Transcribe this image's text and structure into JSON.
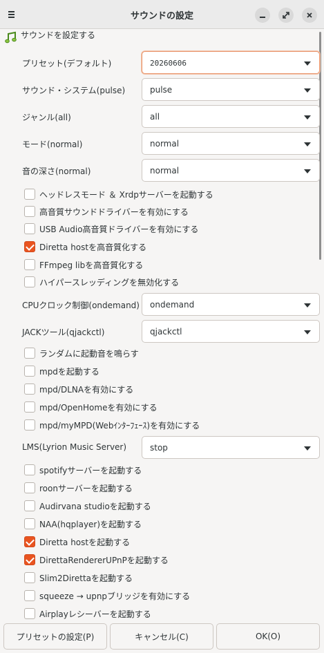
{
  "window": {
    "title": "サウンドの設定"
  },
  "header": {
    "label": "サウンドを設定する",
    "icon": "music-note-icon"
  },
  "preset": {
    "label": "プリセット(デフォルト)",
    "value": "20260606"
  },
  "sound_system": {
    "label": "サウンド・システム(pulse)",
    "value": "pulse"
  },
  "genre": {
    "label": "ジャンル(all)",
    "value": "all"
  },
  "mode": {
    "label": "モード(normal)",
    "value": "normal"
  },
  "depth": {
    "label": "音の深さ(normal)",
    "value": "normal"
  },
  "checks_a": [
    {
      "label": "ヘッドレスモード ＆ Xrdpサーバーを起動する",
      "checked": false
    },
    {
      "label": "高音質サウンドドライバーを有効にする",
      "checked": false
    },
    {
      "label": "USB Audio高音質ドライバーを有効にする",
      "checked": false
    },
    {
      "label": "Diretta hostを高音質化する",
      "checked": true
    },
    {
      "label": "FFmpeg libを高音質化する",
      "checked": false
    },
    {
      "label": "ハイパースレッディングを無効化する",
      "checked": false
    }
  ],
  "cpu": {
    "label": "CPUクロック制御(ondemand)",
    "value": "ondemand"
  },
  "jack": {
    "label": "JACKツール(qjackctl)",
    "value": "qjackctl"
  },
  "checks_b": [
    {
      "label": "ランダムに起動音を鳴らす",
      "checked": false
    },
    {
      "label": "mpdを起動する",
      "checked": false
    },
    {
      "label": "mpd/DLNAを有効にする",
      "checked": false
    },
    {
      "label": "mpd/OpenHomeを有効にする",
      "checked": false
    },
    {
      "label": "mpd/myMPD(Webｲﾝﾀｰﾌｪｰｽ)を有効にする",
      "checked": false
    }
  ],
  "lms": {
    "label": "LMS(Lyrion Music Server)",
    "value": "stop"
  },
  "checks_c": [
    {
      "label": "spotifyサーバーを起動する",
      "checked": false
    },
    {
      "label": "roonサーバーを起動する",
      "checked": false
    },
    {
      "label": "Audirvana studioを起動する",
      "checked": false
    },
    {
      "label": "NAA(hqplayer)を起動する",
      "checked": false
    },
    {
      "label": "Diretta hostを起動する",
      "checked": true
    },
    {
      "label": "DirettaRendererUPnPを起動する",
      "checked": true
    },
    {
      "label": "Slim2Direttaを起動する",
      "checked": false
    },
    {
      "label": "squeeze → upnpブリッジを有効にする",
      "checked": false
    },
    {
      "label": "Airplayレシーバーを起動する",
      "checked": false
    }
  ],
  "footer": {
    "preset_button": "プリセットの設定(P)",
    "cancel_button": "キャンセル(C)",
    "ok_button": "OK(O)"
  },
  "colors": {
    "accent": "#e95420",
    "focus_border": "#e9946b"
  }
}
